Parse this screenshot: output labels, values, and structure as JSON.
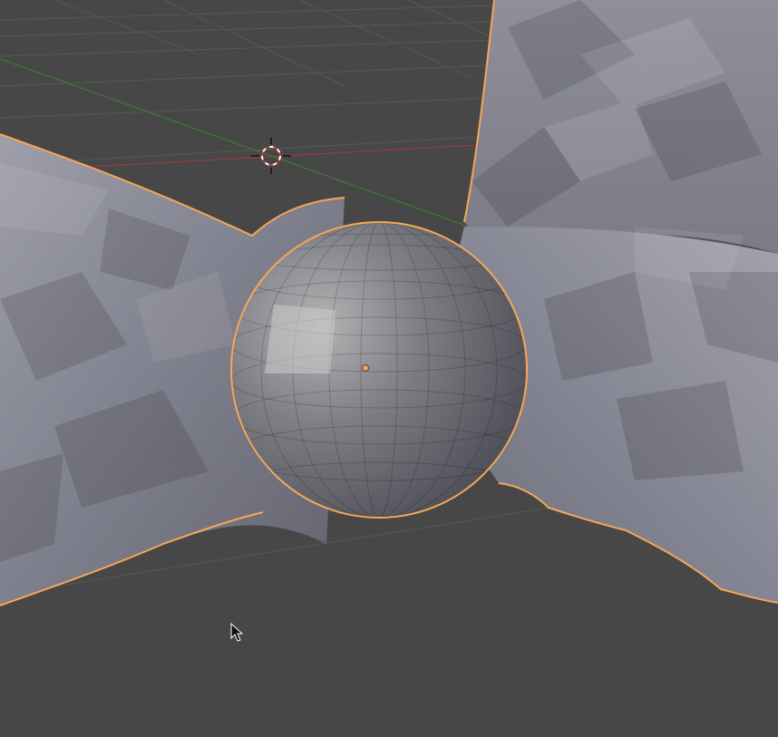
{
  "viewport": {
    "name": "3D Viewport",
    "background": "#474747",
    "grid_color": "#555555",
    "x_axis_color": "#9b3b3b",
    "y_axis_color": "#3d7a35",
    "selection_outline_color": "#f5a657"
  },
  "scene": {
    "objects": [
      {
        "label": "sphere",
        "selected": true,
        "shading": "solid-gray"
      },
      {
        "label": "sculpted-mesh",
        "selected": true,
        "shading": "solid-gray"
      }
    ],
    "origin_point_color": "#f0a050"
  },
  "cursor": {
    "icon": "3d-cursor-icon"
  },
  "pointer": {
    "icon": "mouse-pointer-icon"
  }
}
